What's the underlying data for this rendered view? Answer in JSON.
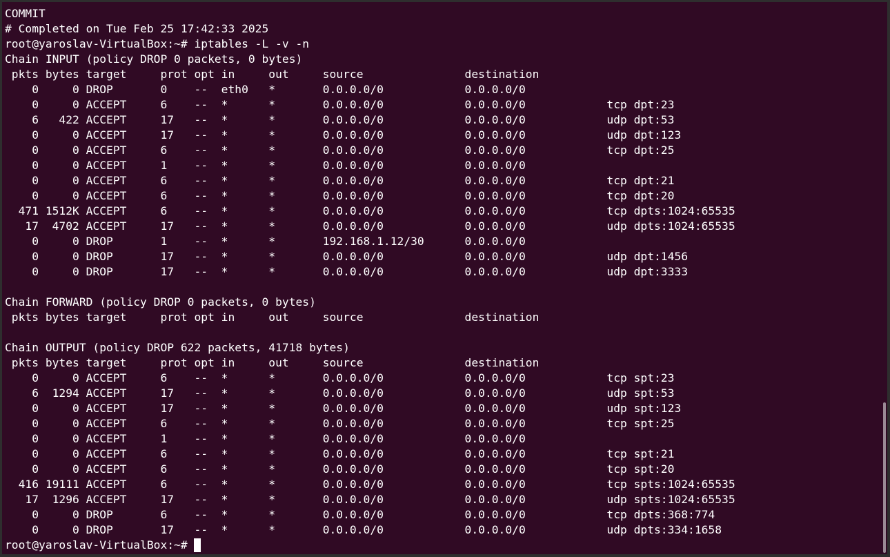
{
  "terminal": {
    "lines": [
      "COMMIT",
      "# Completed on Tue Feb 25 17:42:33 2025",
      "root@yaroslav-VirtualBox:~# iptables -L -v -n",
      "Chain INPUT (policy DROP 0 packets, 0 bytes)",
      " pkts bytes target     prot opt in     out     source               destination",
      "    0     0 DROP       0    --  eth0   *       0.0.0.0/0            0.0.0.0/0",
      "    0     0 ACCEPT     6    --  *      *       0.0.0.0/0            0.0.0.0/0            tcp dpt:23",
      "    6   422 ACCEPT     17   --  *      *       0.0.0.0/0            0.0.0.0/0            udp dpt:53",
      "    0     0 ACCEPT     17   --  *      *       0.0.0.0/0            0.0.0.0/0            udp dpt:123",
      "    0     0 ACCEPT     6    --  *      *       0.0.0.0/0            0.0.0.0/0            tcp dpt:25",
      "    0     0 ACCEPT     1    --  *      *       0.0.0.0/0            0.0.0.0/0",
      "    0     0 ACCEPT     6    --  *      *       0.0.0.0/0            0.0.0.0/0            tcp dpt:21",
      "    0     0 ACCEPT     6    --  *      *       0.0.0.0/0            0.0.0.0/0            tcp dpt:20",
      "  471 1512K ACCEPT     6    --  *      *       0.0.0.0/0            0.0.0.0/0            tcp dpts:1024:65535",
      "   17  4702 ACCEPT     17   --  *      *       0.0.0.0/0            0.0.0.0/0            udp dpts:1024:65535",
      "    0     0 DROP       1    --  *      *       192.168.1.12/30      0.0.0.0/0",
      "    0     0 DROP       17   --  *      *       0.0.0.0/0            0.0.0.0/0            udp dpt:1456",
      "    0     0 DROP       17   --  *      *       0.0.0.0/0            0.0.0.0/0            udp dpt:3333",
      "",
      "Chain FORWARD (policy DROP 0 packets, 0 bytes)",
      " pkts bytes target     prot opt in     out     source               destination",
      "",
      "Chain OUTPUT (policy DROP 622 packets, 41718 bytes)",
      " pkts bytes target     prot opt in     out     source               destination",
      "    0     0 ACCEPT     6    --  *      *       0.0.0.0/0            0.0.0.0/0            tcp spt:23",
      "    6  1294 ACCEPT     17   --  *      *       0.0.0.0/0            0.0.0.0/0            udp spt:53",
      "    0     0 ACCEPT     17   --  *      *       0.0.0.0/0            0.0.0.0/0            udp spt:123",
      "    0     0 ACCEPT     6    --  *      *       0.0.0.0/0            0.0.0.0/0            tcp spt:25",
      "    0     0 ACCEPT     1    --  *      *       0.0.0.0/0            0.0.0.0/0",
      "    0     0 ACCEPT     6    --  *      *       0.0.0.0/0            0.0.0.0/0            tcp spt:21",
      "    0     0 ACCEPT     6    --  *      *       0.0.0.0/0            0.0.0.0/0            tcp spt:20",
      "  416 19111 ACCEPT     6    --  *      *       0.0.0.0/0            0.0.0.0/0            tcp spts:1024:65535",
      "   17  1296 ACCEPT     17   --  *      *       0.0.0.0/0            0.0.0.0/0            udp spts:1024:65535",
      "    0     0 DROP       6    --  *      *       0.0.0.0/0            0.0.0.0/0            tcp dpts:368:774",
      "    0     0 DROP       17   --  *      *       0.0.0.0/0            0.0.0.0/0            udp dpts:334:1658"
    ],
    "prompt": "root@yaroslav-VirtualBox:~# ",
    "colors": {
      "background": "#300a24",
      "foreground": "#ffffff",
      "scrollbar": "#9a8a95"
    }
  }
}
